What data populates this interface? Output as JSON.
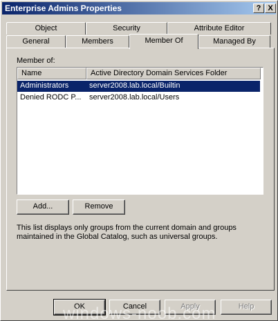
{
  "window": {
    "title": "Enterprise Admins Properties",
    "help_button": "?",
    "close_button": "X"
  },
  "tabs": {
    "row_back": [
      "Object",
      "Security",
      "Attribute Editor"
    ],
    "row_front": [
      "General",
      "Members",
      "Member Of",
      "Managed By"
    ],
    "active": "Member Of"
  },
  "member_of": {
    "label": "Member of:",
    "columns": [
      "Name",
      "Active Directory Domain Services Folder"
    ],
    "rows": [
      {
        "name": "Administrators",
        "folder": "server2008.lab.local/Builtin",
        "selected": true
      },
      {
        "name": "Denied RODC P...",
        "folder": "server2008.lab.local/Users",
        "selected": false
      }
    ],
    "add_button": "Add...",
    "remove_button": "Remove",
    "description": "This list displays only groups from the current domain and groups maintained in the Global Catalog, such as universal groups."
  },
  "footer": {
    "ok": "OK",
    "cancel": "Cancel",
    "apply": "Apply",
    "help": "Help"
  },
  "watermark": "windows-noob.com",
  "colors": {
    "title_start": "#0a246a",
    "title_end": "#a6caf0",
    "selection": "#0a246a",
    "face": "#d4d0c8"
  }
}
